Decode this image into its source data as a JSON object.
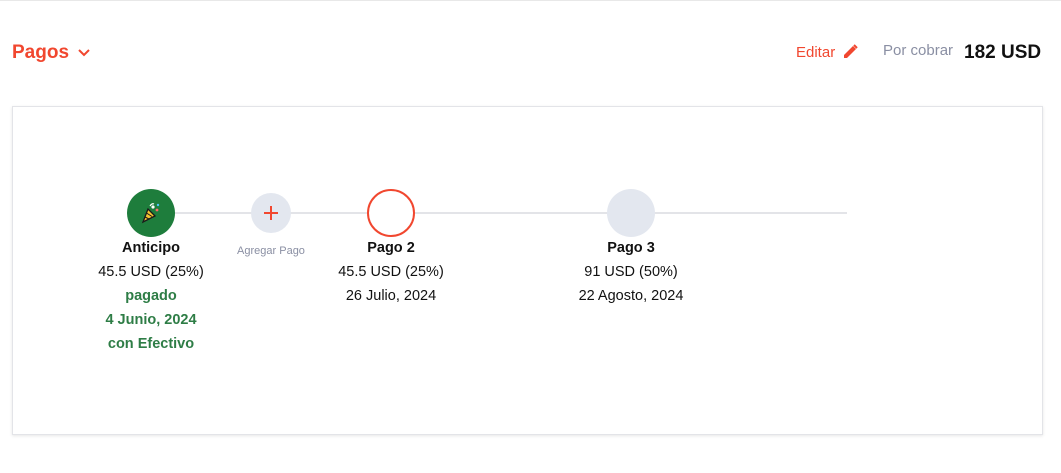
{
  "header": {
    "title": "Pagos",
    "edit_label": "Editar",
    "receivable_label": "Por cobrar",
    "receivable_amount": "182 USD"
  },
  "colors": {
    "accent": "#f1472f",
    "paid_green": "#1e7d3c",
    "muted": "#8a8fa3",
    "node_gray": "#e3e7ef"
  },
  "timeline": {
    "add_payment_label": "Agregar Pago",
    "payments": [
      {
        "title": "Anticipo",
        "amount": "45.5 USD (25%)",
        "status": "pagado",
        "date": "4 Junio, 2024",
        "method": "con Efectivo",
        "icon": "party-popper-icon"
      },
      {
        "title": "Pago 2",
        "amount": "45.5 USD (25%)",
        "date": "26 Julio, 2024"
      },
      {
        "title": "Pago 3",
        "amount": "91 USD (50%)",
        "date": "22 Agosto, 2024"
      }
    ]
  }
}
